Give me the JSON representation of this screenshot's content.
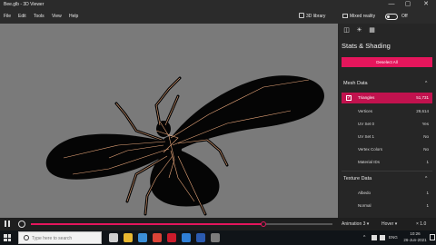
{
  "window": {
    "title": "Bee.glb - 3D Viewer",
    "controls": [
      "—",
      "▢",
      "✕"
    ]
  },
  "menu": {
    "items": [
      "File",
      "Edit",
      "Tools",
      "View",
      "Help"
    ],
    "library_label": "3D library",
    "mixed_quality_label": "Mixed reality",
    "toggle_state_label": "Off"
  },
  "panel": {
    "tab_icons": [
      "cube-icon",
      "sun-icon",
      "grid-icon"
    ],
    "title": "Stats & Shading",
    "deselect_label": "Deselect All",
    "mesh_section": "Mesh Data",
    "texture_section": "Texture Data",
    "mesh_rows": [
      {
        "label": "Triangles",
        "value": "51,731",
        "selected": true
      },
      {
        "label": "Vertices",
        "value": "29,614"
      },
      {
        "label": "UV Set 0",
        "value": "Yes"
      },
      {
        "label": "UV Set 1",
        "value": "No"
      },
      {
        "label": "Vertex Colors",
        "value": "No"
      },
      {
        "label": "Material IDs",
        "value": "1"
      }
    ],
    "texture_rows": [
      {
        "label": "Albedo",
        "value": "1"
      },
      {
        "label": "Normal",
        "value": "1"
      }
    ],
    "chevron": "^",
    "chevron_down": "v"
  },
  "player": {
    "progress": 0.77,
    "animation_label": "Animation 3 ▾",
    "mode_label": "Hover ▾",
    "speed_label": "× 1.0"
  },
  "taskbar": {
    "search_placeholder": "Type here to search",
    "apps": [
      {
        "icon": "task-view-icon",
        "color": "#cfcfcf"
      },
      {
        "icon": "file-explorer-icon",
        "color": "#e8b830"
      },
      {
        "icon": "edge-icon",
        "color": "#3b8fd8"
      },
      {
        "icon": "chrome-icon",
        "color": "#db4437"
      },
      {
        "icon": "opera-icon",
        "color": "#cc1b2b"
      },
      {
        "icon": "mail-icon",
        "color": "#2f7fd6"
      },
      {
        "icon": "word-icon",
        "color": "#2b5bb0"
      },
      {
        "icon": "3d-viewer-icon",
        "color": "#7c7c7c"
      }
    ],
    "tray_chevron": "^",
    "language": "ENG",
    "time": "10:26",
    "date": "26-Jun-2021"
  },
  "colors": {
    "accent": "#e5165c",
    "viewport_bg": "#7a7a7a",
    "model_fill": "#050505",
    "wireframe": "#e8a67a"
  }
}
